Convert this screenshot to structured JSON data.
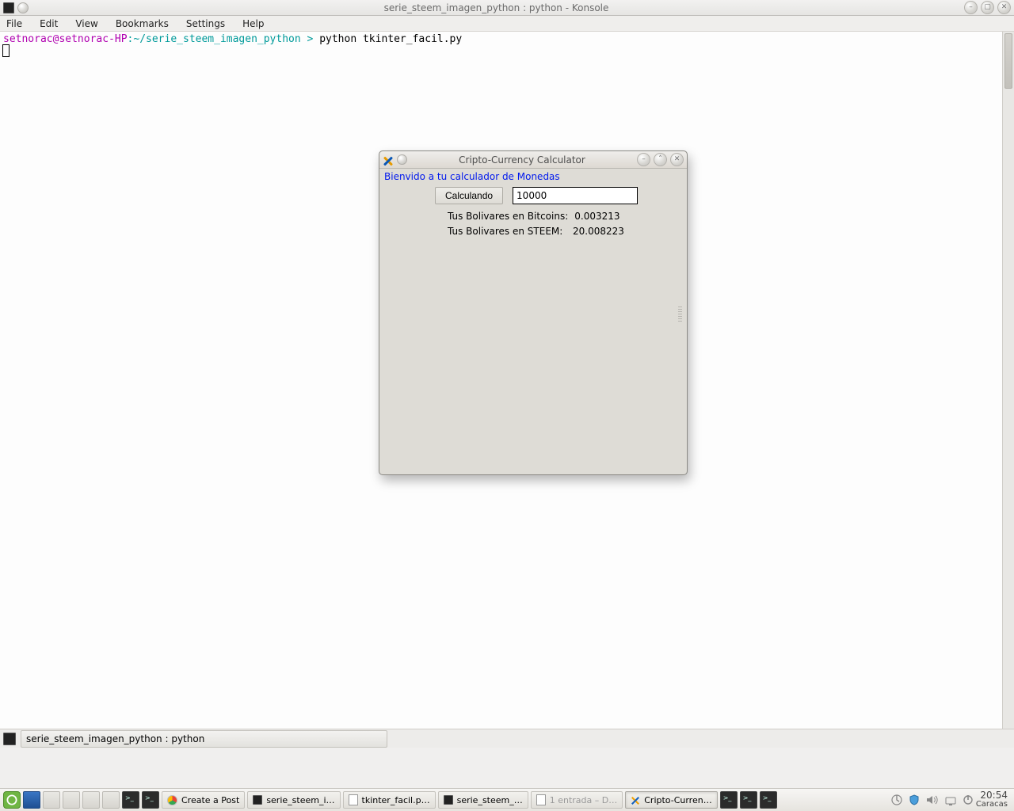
{
  "konsole": {
    "title": "serie_steem_imagen_python : python - Konsole",
    "menu": {
      "file": "File",
      "edit": "Edit",
      "view": "View",
      "bookmarks": "Bookmarks",
      "settings": "Settings",
      "help": "Help"
    },
    "prompt": {
      "user": "setnorac",
      "host": "@setnorac-HP",
      "path": ":~/serie_steem_imagen_python",
      "sep": " > ",
      "command": "python tkinter_facil.py"
    },
    "tab_label": "serie_steem_imagen_python : python"
  },
  "tk": {
    "title": "Cripto-Currency Calculator",
    "welcome": "Bienvido a tu calculador de Monedas",
    "button": "Calculando",
    "entry_value": "10000",
    "results": [
      {
        "label": "Tus Bolivares en Bitcoins:",
        "value": "0.003213"
      },
      {
        "label": "Tus Bolivares en STEEM:",
        "value": "20.008223"
      }
    ]
  },
  "taskbar": {
    "items": [
      {
        "name": "create-post",
        "label": "Create a Post"
      },
      {
        "name": "serie-steem-1",
        "label": "serie_steem_i…"
      },
      {
        "name": "tkinter-facil",
        "label": "tkinter_facil.p…"
      },
      {
        "name": "serie-steem-2",
        "label": "serie_steem_…"
      },
      {
        "name": "entrada",
        "label": "1 entrada – D…"
      },
      {
        "name": "cripto-currenc",
        "label": "Cripto-Curren…"
      }
    ],
    "clock": {
      "time": "20:54",
      "zone": "Caracas"
    }
  }
}
